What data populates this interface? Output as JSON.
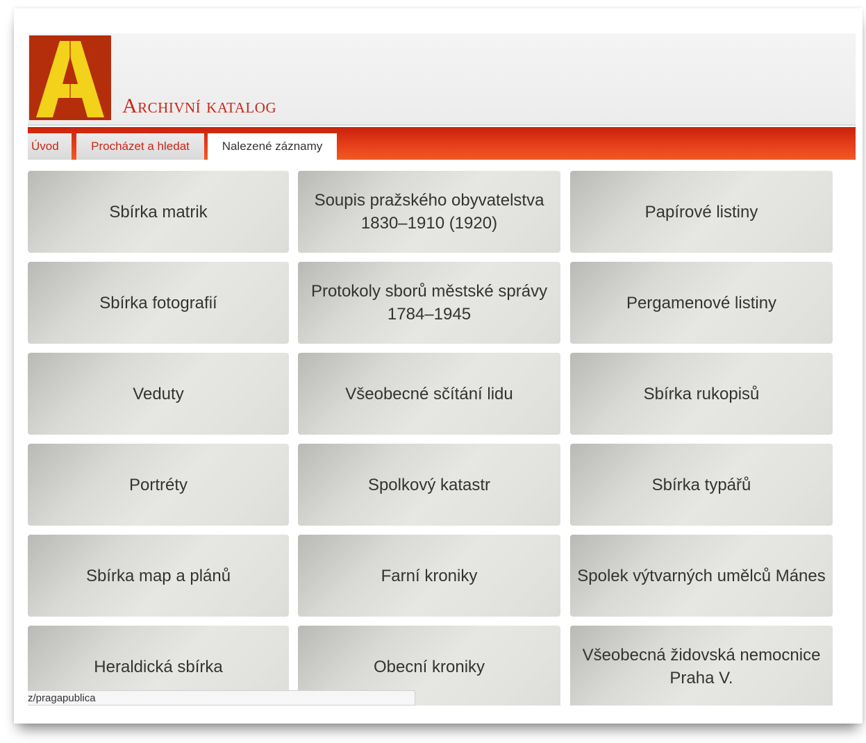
{
  "header": {
    "logo_letter": "A",
    "title": "Archivní katalog"
  },
  "nav": {
    "tabs": [
      {
        "label": "Úvod",
        "active": false
      },
      {
        "label": "Procházet a hledat",
        "active": false
      },
      {
        "label": "Nalezené záznamy",
        "active": true
      }
    ]
  },
  "tiles": [
    "Sbírka matrik",
    "Soupis pražského obyvatelstva 1830–1910 (1920)",
    "Papírové listiny",
    "Sbírka fotografií",
    "Protokoly sborů městské správy 1784–1945",
    "Pergamenové listiny",
    "Veduty",
    "Všeobecné sčítání lidu",
    "Sbírka rukopisů",
    "Portréty",
    "Spolkový katastr",
    "Sbírka typářů",
    "Sbírka map a plánů",
    "Farní kroniky",
    "Spolek výtvarných umělců Mánes",
    "Heraldická sbírka",
    "Obecní kroniky",
    "Všeobecná židovská nemocnice Praha V."
  ],
  "status_url": "z/pragapublica",
  "colors": {
    "brand_red": "#c8281a",
    "logo_bg": "#b52e0c",
    "logo_letter": "#f2d21a",
    "navbar": "#e8411b"
  }
}
